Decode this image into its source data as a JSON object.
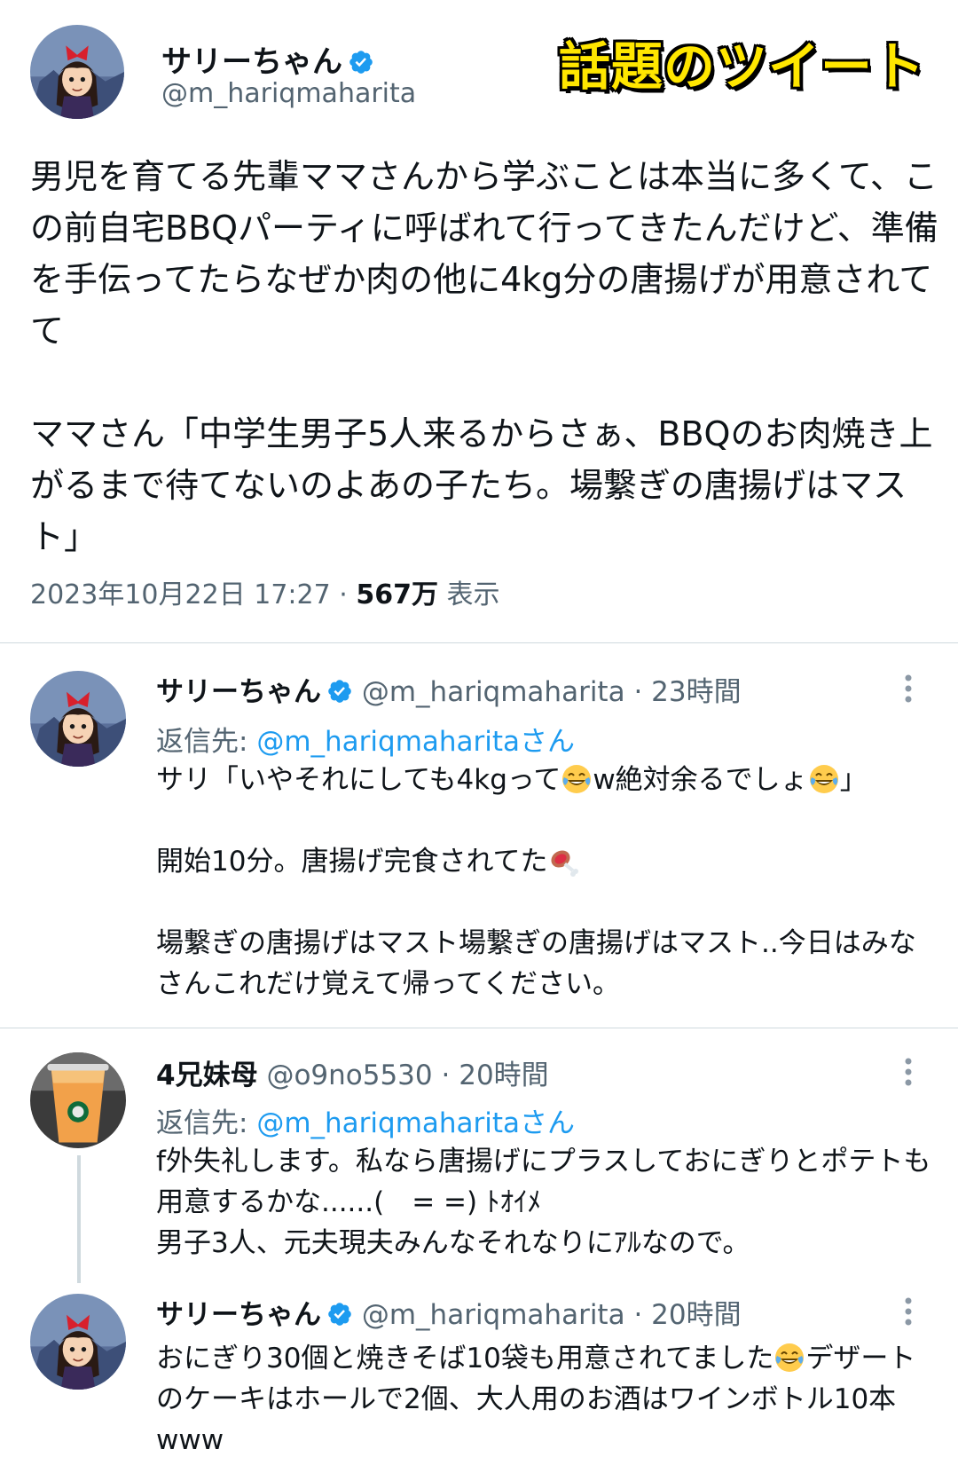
{
  "badge": "話題のツイート",
  "main_tweet": {
    "name": "サリーちゃん",
    "handle": "@m_hariqmaharita",
    "paragraphs": [
      "男児を育てる先輩ママさんから学ぶことは本当に多くて、この前自宅BBQパーティに呼ばれて行ってきたんだけど、準備を手伝ってたらなぜか肉の他に4kg分の唐揚げが用意されてて",
      "ママさん「中学生男子5人来るからさぁ、BBQのお肉焼き上がるまで待てないのよあの子たち。場繋ぎの唐揚げはマスト」"
    ],
    "timestamp": "2023年10月22日 17:27",
    "separator": "·",
    "views_count": "567万",
    "views_label": "表示"
  },
  "replies": [
    {
      "name": "サリーちゃん",
      "verified": true,
      "handle": "@m_hariqmaharita",
      "dot": "·",
      "time": "23時間",
      "reply_prefix": "返信先: ",
      "reply_target": "@m_hariqmaharitaさん",
      "line1_a": "サリ「いやそれにしても4kgって",
      "line1_b": "w絶対余るでしょ",
      "line1_c": "」",
      "line2": "開始10分。唐揚げ完食されてた",
      "line3": "場繋ぎの唐揚げはマスト場繋ぎの唐揚げはマスト..今日はみなさんこれだけ覚えて帰ってください。"
    },
    {
      "name": "4兄妹母",
      "verified": false,
      "handle": "@o9no5530",
      "dot": "·",
      "time": "20時間",
      "reply_prefix": "返信先: ",
      "reply_target": "@m_hariqmaharitaさん",
      "line1": "f外失礼します。私なら唐揚げにプラスしておにぎりとポテトも用意するかな......(　= =) ﾄｵｲﾒ",
      "line2": "男子3人、元夫現夫みんなそれなりにｱﾙなので。"
    },
    {
      "name": "サリーちゃん",
      "verified": true,
      "handle": "@m_hariqmaharita",
      "dot": "·",
      "time": "20時間",
      "line1_a": "おにぎり30個と焼きそば10袋も用意されてました",
      "line1_b": "デザートのケーキはホールで2個、大人用のお酒はワインボトル10本www"
    }
  ],
  "icons": {
    "verified": "verified-badge-icon",
    "more": "more-vertical-icon",
    "laugh": "tears-of-joy-emoji",
    "meat": "meat-on-bone-emoji"
  },
  "colors": {
    "link": "#1d9bf0",
    "secondary_text": "#536471",
    "badge_fill": "#ffe600"
  }
}
